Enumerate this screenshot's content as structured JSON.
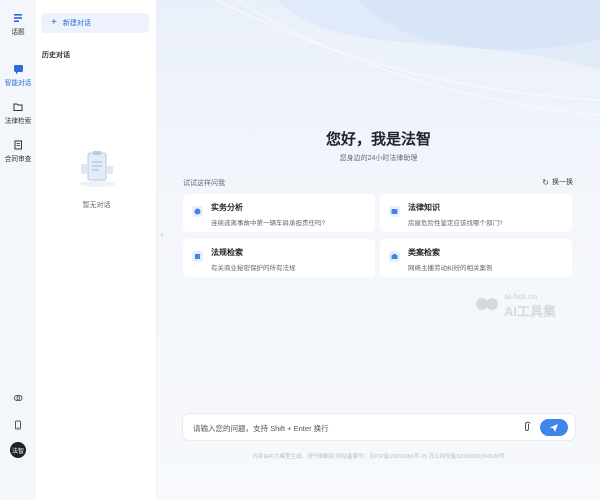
{
  "rail": {
    "items": [
      {
        "label": "话题",
        "icon": "list-icon"
      },
      {
        "label": "智能对话",
        "icon": "chat-icon"
      },
      {
        "label": "法律检索",
        "icon": "folder-icon"
      },
      {
        "label": "合同审查",
        "icon": "document-icon"
      }
    ],
    "avatar_text": "法智"
  },
  "history": {
    "new_chat_label": "新建对话",
    "title": "历史对话",
    "empty_text": "暂无对话"
  },
  "main": {
    "greeting": "您好，我是法智",
    "subtitle": "您身边的24小时法律助理",
    "try_label": "试试这样问我",
    "refresh_label": "换一换",
    "cards": [
      {
        "title": "实务分析",
        "desc": "连续逃离事故中第一辆车肩承担责任吗?"
      },
      {
        "title": "法律知识",
        "desc": "房屋危险性鉴定应该找哪个部门?"
      },
      {
        "title": "法规检索",
        "desc": "有关商业秘密保护的所有法规"
      },
      {
        "title": "类案检索",
        "desc": "网络主播劳动纠纷的相关案例"
      }
    ],
    "watermark_top": "ai-bot.cn",
    "watermark_bottom": "AI工具集"
  },
  "input": {
    "placeholder": "请输入您的问题，支持 Shift + Enter 换行"
  },
  "footer": "内容由AI大模型生成，请仔细甄别    网站备案号：苏ICP备15056286号-35    苏公网安备32059002004538号",
  "colors": {
    "accent": "#2f6bd8",
    "send": "#3f86e8",
    "rail_bg": "#f3f6fb"
  }
}
